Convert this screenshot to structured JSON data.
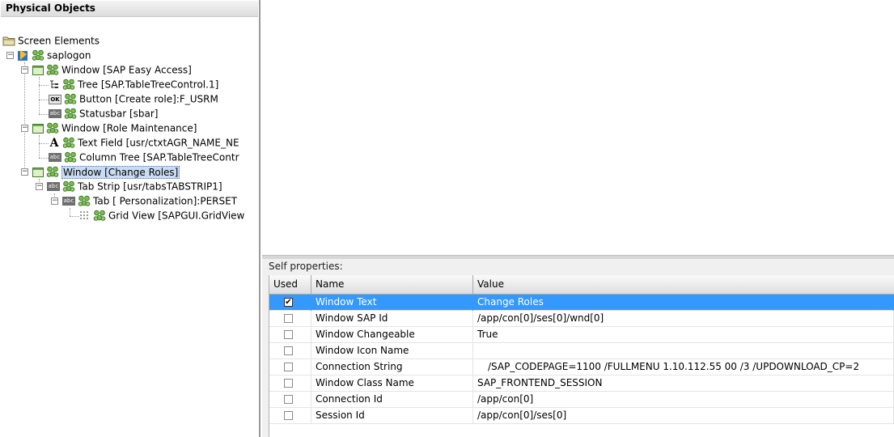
{
  "left_panel": {
    "title": "Physical Objects"
  },
  "tree": {
    "root": "Screen Elements",
    "app": "saplogon",
    "window1": "Window [SAP Easy Access]",
    "tree1": "Tree [SAP.TableTreeControl.1]",
    "button1": "Button [Create role]:F_USRM",
    "statusbar1": "Statusbar [sbar]",
    "window2": "Window [Role Maintenance]",
    "textfield1": "Text Field [usr/ctxtAGR_NAME_NE",
    "columntree1": "Column Tree [SAP.TableTreeContr",
    "window3": "Window [Change Roles]",
    "tabstrip1": "Tab Strip [usr/tabsTABSTRIP1]",
    "tab1": "Tab [ Personalization]:PERSET",
    "gridview1": "Grid View [SAPGUI.GridView"
  },
  "properties": {
    "label": "Self properties:",
    "headers": {
      "used": "Used",
      "name": "Name",
      "value": "Value"
    },
    "rows": [
      {
        "name": "Window Text",
        "value": "Change Roles",
        "used": true
      },
      {
        "name": "Window SAP Id",
        "value": "/app/con[0]/ses[0]/wnd[0]",
        "used": false
      },
      {
        "name": "Window Changeable",
        "value": "True",
        "used": false
      },
      {
        "name": "Window Icon Name",
        "value": "",
        "used": false
      },
      {
        "name": "Connection String",
        "value": "/SAP_CODEPAGE=1100  /FULLMENU  1.10.112.55 00 /3 /UPDOWNLOAD_CP=2",
        "used": false
      },
      {
        "name": "Window Class Name",
        "value": "SAP_FRONTEND_SESSION",
        "used": false
      },
      {
        "name": "Connection Id",
        "value": "/app/con[0]",
        "used": false
      },
      {
        "name": "Session Id",
        "value": "/app/con[0]/ses[0]",
        "used": false
      }
    ],
    "check_mark": "✔"
  },
  "colors": {
    "selected_row": "#3399ff",
    "tree_selected": "#c9dcf3"
  }
}
